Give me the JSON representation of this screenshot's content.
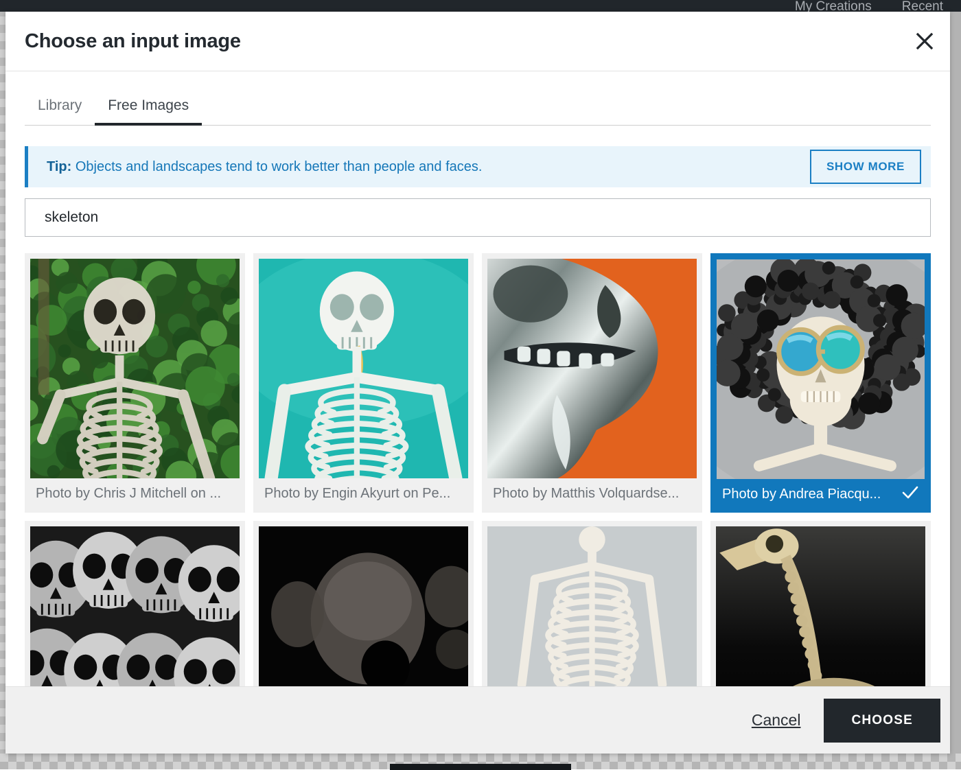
{
  "app": {
    "topnav": [
      {
        "label": "My Creations"
      },
      {
        "label": "Recent"
      }
    ]
  },
  "modal": {
    "title": "Choose an input image",
    "close_label": "×",
    "tabs": [
      {
        "label": "Library",
        "active": false
      },
      {
        "label": "Free Images",
        "active": true
      }
    ],
    "tip": {
      "prefix": "Tip:",
      "text": " Objects and landscapes tend to work better than people and faces.",
      "show_more_label": "SHOW MORE",
      "accent_color": "#1b7fc4",
      "background_color": "#e8f4fb"
    },
    "search": {
      "value": "skeleton",
      "placeholder": "Search free images"
    },
    "results": [
      {
        "caption": "Photo by Chris J Mitchell on ...",
        "selected": false,
        "art": "skeleton-in-forest"
      },
      {
        "caption": "Photo by Engin Akyurt on Pe...",
        "selected": false,
        "art": "skeleton-teal"
      },
      {
        "caption": "Photo by Matthis Volquardse...",
        "selected": false,
        "art": "chrome-skull-orange"
      },
      {
        "caption": "Photo by Andrea Piacqu...",
        "selected": true,
        "art": "skull-afro-sunglasses"
      },
      {
        "caption": "",
        "selected": false,
        "art": "skull-pile-bw"
      },
      {
        "caption": "",
        "selected": false,
        "art": "dark-skull"
      },
      {
        "caption": "",
        "selected": false,
        "art": "skeleton-torso-grey"
      },
      {
        "caption": "",
        "selected": false,
        "art": "bird-skeleton-dark"
      }
    ],
    "footer": {
      "cancel_label": "Cancel",
      "choose_label": "CHOOSE"
    },
    "selection_color": "#1178bc"
  }
}
